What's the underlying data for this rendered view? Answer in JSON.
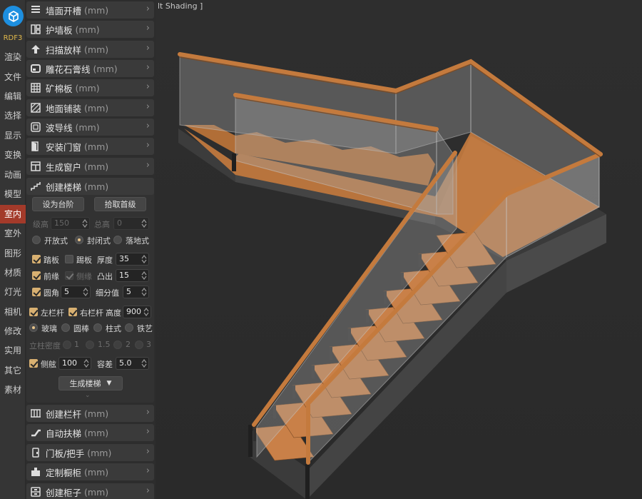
{
  "brand": "RDF3",
  "categories": [
    {
      "label": "渲染",
      "active": false
    },
    {
      "label": "文件",
      "active": false
    },
    {
      "label": "编辑",
      "active": false
    },
    {
      "label": "选择",
      "active": false
    },
    {
      "label": "显示",
      "active": false
    },
    {
      "label": "变换",
      "active": false
    },
    {
      "label": "动画",
      "active": false
    },
    {
      "label": "模型",
      "active": false
    },
    {
      "label": "室内",
      "active": true
    },
    {
      "label": "室外",
      "active": false
    },
    {
      "label": "图形",
      "active": false
    },
    {
      "label": "材质",
      "active": false
    },
    {
      "label": "灯光",
      "active": false
    },
    {
      "label": "相机",
      "active": false
    },
    {
      "label": "修改",
      "active": false
    },
    {
      "label": "实用",
      "active": false
    },
    {
      "label": "其它",
      "active": false
    },
    {
      "label": "素材",
      "active": false
    }
  ],
  "tools_top": [
    {
      "label": "墙面开槽",
      "unit": "(mm)",
      "icon": "list-icon"
    },
    {
      "label": "护墙板",
      "unit": "(mm)",
      "icon": "wall-panel-icon"
    },
    {
      "label": "扫描放样",
      "unit": "(mm)",
      "icon": "upload-icon"
    },
    {
      "label": "雕花石膏线",
      "unit": "(mm)",
      "icon": "molding-icon"
    },
    {
      "label": "矿棉板",
      "unit": "(mm)",
      "icon": "grid-icon"
    },
    {
      "label": "地面铺装",
      "unit": "(mm)",
      "icon": "floor-icon"
    },
    {
      "label": "波导线",
      "unit": "(mm)",
      "icon": "wave-icon"
    },
    {
      "label": "安装门窗",
      "unit": "(mm)",
      "icon": "door-icon"
    },
    {
      "label": "生成窗户",
      "unit": "(mm)",
      "icon": "window-icon"
    }
  ],
  "stair": {
    "title": "创建楼梯",
    "unit": "(mm)",
    "btn_set_step": "设为台阶",
    "btn_pick_first": "拾取首级",
    "step_height_label": "级高",
    "step_height": "150",
    "total_height_label": "总高",
    "total_height": "0",
    "open": "开放式",
    "closed": "封闭式",
    "floor": "落地式",
    "tread": "踏板",
    "riser": "踢板",
    "thickness_label": "厚度",
    "thickness": "35",
    "nosing": "前缘",
    "side_edge": "侧缘",
    "protrude_label": "凸出",
    "protrude": "15",
    "fillet": "圆角",
    "fillet_val": "5",
    "subdiv_label": "细分值",
    "subdiv": "5",
    "left_rail": "左栏杆",
    "right_rail": "右栏杆",
    "rail_height_label": "高度",
    "rail_height": "900",
    "glass": "玻璃",
    "round_bar": "圆棒",
    "column": "柱式",
    "iron": "铁艺",
    "density_label": "立柱密度",
    "density_1": "1",
    "density_15": "1.5",
    "density_2": "2",
    "density_3": "3",
    "side_beam": "侧舷",
    "side_beam_val": "100",
    "tolerance_label": "容差",
    "tolerance": "5.0",
    "generate": "生成楼梯"
  },
  "tools_bottom": [
    {
      "label": "创建栏杆",
      "unit": "(mm)",
      "icon": "railing-icon"
    },
    {
      "label": "自动扶梯",
      "unit": "(mm)",
      "icon": "escalator-icon"
    },
    {
      "label": "门板/把手",
      "unit": "(mm)",
      "icon": "door-handle-icon"
    },
    {
      "label": "定制橱柜",
      "unit": "(mm)",
      "icon": "cabinet-icon"
    },
    {
      "label": "创建柜子",
      "unit": "(mm)",
      "icon": "cupboard-icon"
    }
  ],
  "viewport_title": "lt Shading ]"
}
